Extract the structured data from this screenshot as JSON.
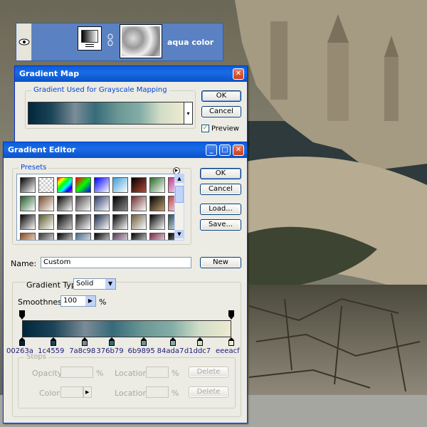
{
  "layer": {
    "name": "aqua color",
    "icons": [
      "eye-icon",
      "link-icon"
    ]
  },
  "gradient_map": {
    "title": "Gradient Map",
    "group_label": "Gradient Used for Grayscale Mapping",
    "ok": "OK",
    "cancel": "Cancel",
    "preview": "Preview",
    "preview_checked": true,
    "close_icon": "close-icon"
  },
  "gradient_editor": {
    "title": "Gradient Editor",
    "presets_label": "Presets",
    "buttons": {
      "ok": "OK",
      "cancel": "Cancel",
      "load": "Load...",
      "save": "Save...",
      "new": "New"
    },
    "name_label": "Name:",
    "name_value": "Custom",
    "gradient_type_label": "Gradient Type:",
    "gradient_type_value": "Solid",
    "smoothness_label": "Smoothness:",
    "smoothness_value": "100",
    "smoothness_unit": "%",
    "stops_label": "Stops",
    "opacity_label": "Opacity:",
    "color_label": "Color:",
    "location_label": "Location:",
    "location_unit": "%",
    "delete_label": "Delete",
    "color_stops": [
      "00263a",
      "1c4559",
      "7a8c98",
      "376b79",
      "6b9895",
      "84ada7",
      "d1ddc7",
      "eeeacf"
    ],
    "stop_colors": [
      "#00263a",
      "#1c4559",
      "#7a8c98",
      "#376b79",
      "#6b9895",
      "#84ada7",
      "#d1ddc7",
      "#eeeacf"
    ],
    "stop_locations": [
      0,
      15,
      30,
      43,
      58,
      72,
      85,
      100
    ]
  }
}
